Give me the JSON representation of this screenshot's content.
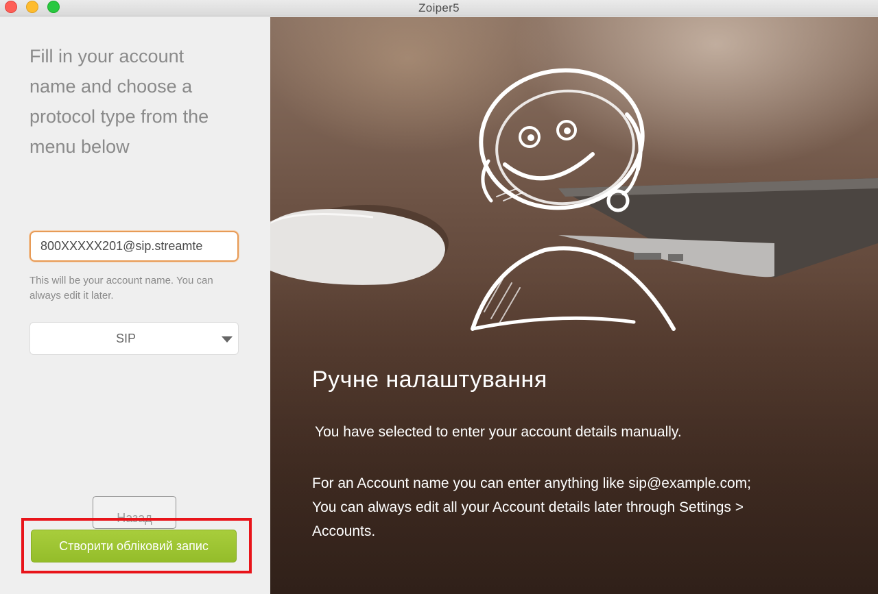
{
  "window": {
    "title": "Zoiper5"
  },
  "left_panel": {
    "instructions": "Fill in your account\nname and choose a\nprotocol type from the\nmenu below",
    "account_name_value": "800XXXXX201@sip.streamte",
    "helper_text": "This will be your account name. You can always edit it later.",
    "protocol_selected": "SIP",
    "back_label": "Назад",
    "create_label": "Створити обліковий запис",
    "accent_color": "#9bc433",
    "input_focus_color": "#e79b57",
    "highlight_color": "#e8141a"
  },
  "hero": {
    "title": "Ручне налаштування",
    "line1": "You have selected to enter your account details manually.",
    "line2": "For an Account name you can enter anything like sip@example.com; You can always edit all your Account details later through Settings > Accounts."
  },
  "icons": [
    "close-icon",
    "minimize-icon",
    "maximize-icon",
    "chevron-down-icon",
    "smiley-headset-icon"
  ]
}
